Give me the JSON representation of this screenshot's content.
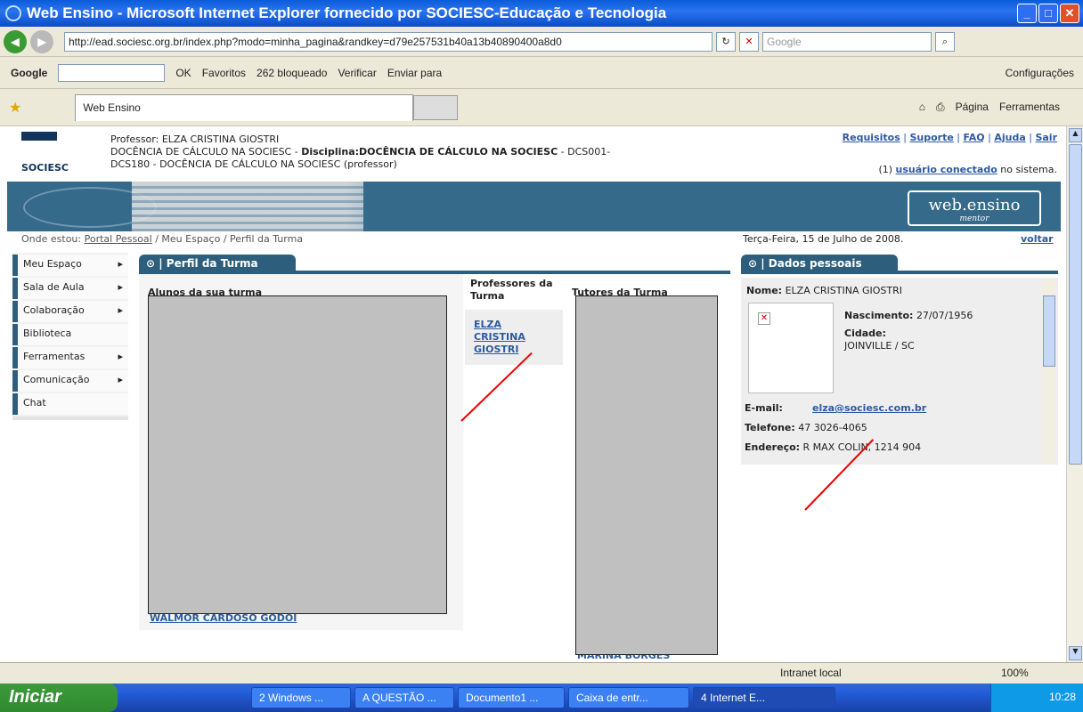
{
  "window": {
    "title": "Web Ensino - Microsoft Internet Explorer fornecido por SOCIESC-Educação e Tecnologia"
  },
  "address": {
    "url": "http://ead.sociesc.org.br/index.php?modo=minha_pagina&randkey=d79e257531b40a13b40890400a8d0",
    "search_placeholder": "Google"
  },
  "googlebar": {
    "label": "Google",
    "items": [
      "OK",
      "Favoritos",
      "262 bloqueado",
      "Verificar",
      "Enviar para",
      "Configurações"
    ]
  },
  "tabs": {
    "active": "Web Ensino"
  },
  "toolbar_right": [
    "Página",
    "Ferramentas"
  ],
  "header": {
    "professor_line": "Professor: ELZA CRISTINA GIOSTRI",
    "disciplina_prefix": "DOCÊNCIA DE CÁLCULO NA SOCIESC - ",
    "disciplina_bold": "Disciplina:DOCÊNCIA DE CÁLCULO NA SOCIESC",
    "disciplina_suffix": " - DCS001-",
    "turma_line": "DCS180 - DOCÊNCIA DE CÁLCULO NA SOCIESC (professor)",
    "logo_text": "SOCIESC",
    "links": [
      "Requisitos",
      "Suporte",
      "FAQ",
      "Ajuda",
      "Sair"
    ],
    "online_count": "(1)",
    "online_link": "usuário conectado",
    "online_suffix": " no sistema.",
    "brand": "web.ensino",
    "brand_sub": "mentor"
  },
  "breadcrumb": {
    "label": "Onde estou:",
    "portal": "Portal Pessoal",
    "rest": " / Meu Espaço / Perfil da Turma"
  },
  "date": "Terça-Feira, 15 de Julho de 2008.",
  "voltar": "voltar",
  "menu": [
    {
      "label": "Meu Espaço",
      "arrow": "▸"
    },
    {
      "label": "Sala de Aula",
      "arrow": "▸"
    },
    {
      "label": "Colaboração",
      "arrow": "▸"
    },
    {
      "label": "Biblioteca",
      "arrow": ""
    },
    {
      "label": "Ferramentas",
      "arrow": "▸"
    },
    {
      "label": "Comunicação",
      "arrow": "▸"
    },
    {
      "label": "Chat",
      "arrow": ""
    }
  ],
  "perfil": {
    "title": "Perfil da Turma",
    "col_alunos": "Alunos da sua turma",
    "col_professores": "Professores da Turma",
    "col_tutores": "Tutores da Turma",
    "professor_name": "ELZA CRISTINA GIOSTRI",
    "last_student": "WALMOR CARDOSO GODOI",
    "last_tutor": "MARINA BORGES"
  },
  "dados": {
    "title": "Dados pessoais",
    "nome_label": "Nome:",
    "nome": "ELZA CRISTINA GIOSTRI",
    "nasc_label": "Nascimento:",
    "nasc": "27/07/1956",
    "cidade_label": "Cidade:",
    "cidade": "JOINVILLE / SC",
    "email_label": "E-mail:",
    "email": "elza@sociesc.com.br",
    "telefone_label": "Telefone:",
    "telefone": "47 3026-4065",
    "endereco_label": "Endereço:",
    "endereco": "R MAX COLIN, 1214 904"
  },
  "status": {
    "zone": "Intranet local",
    "zoom": "100%"
  },
  "taskbar": {
    "start": "Iniciar",
    "items": [
      "2 Windows ...",
      "A QUESTÃO ...",
      "Documento1 ...",
      "Caixa de entr...",
      "4 Internet E..."
    ],
    "clock": "10:28"
  },
  "colors": {
    "teal": "#2d5f7d",
    "link": "#2c5aa0",
    "xp_blue": "#0a5bd8"
  }
}
